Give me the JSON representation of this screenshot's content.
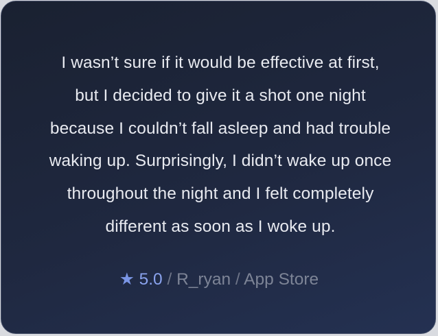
{
  "testimonial": {
    "lines": [
      "I wasn’t sure if it would be effective at first,",
      "but I decided to give it a shot one night",
      "because I couldn’t fall asleep and had trouble",
      "waking up. Surprisingly, I didn’t wake up once",
      "throughout the night and I felt completely",
      "different as soon as I woke up."
    ],
    "star_icon": "star-icon",
    "star_glyph": "★",
    "rating": "5.0",
    "separator": " / ",
    "author": "R_ryan",
    "source": "App Store",
    "colors": {
      "accent": "#8aa3ee",
      "text": "#e8eaf0",
      "muted": "#7d8496",
      "card_top": "#1a2131",
      "card_bottom": "#243152"
    }
  }
}
